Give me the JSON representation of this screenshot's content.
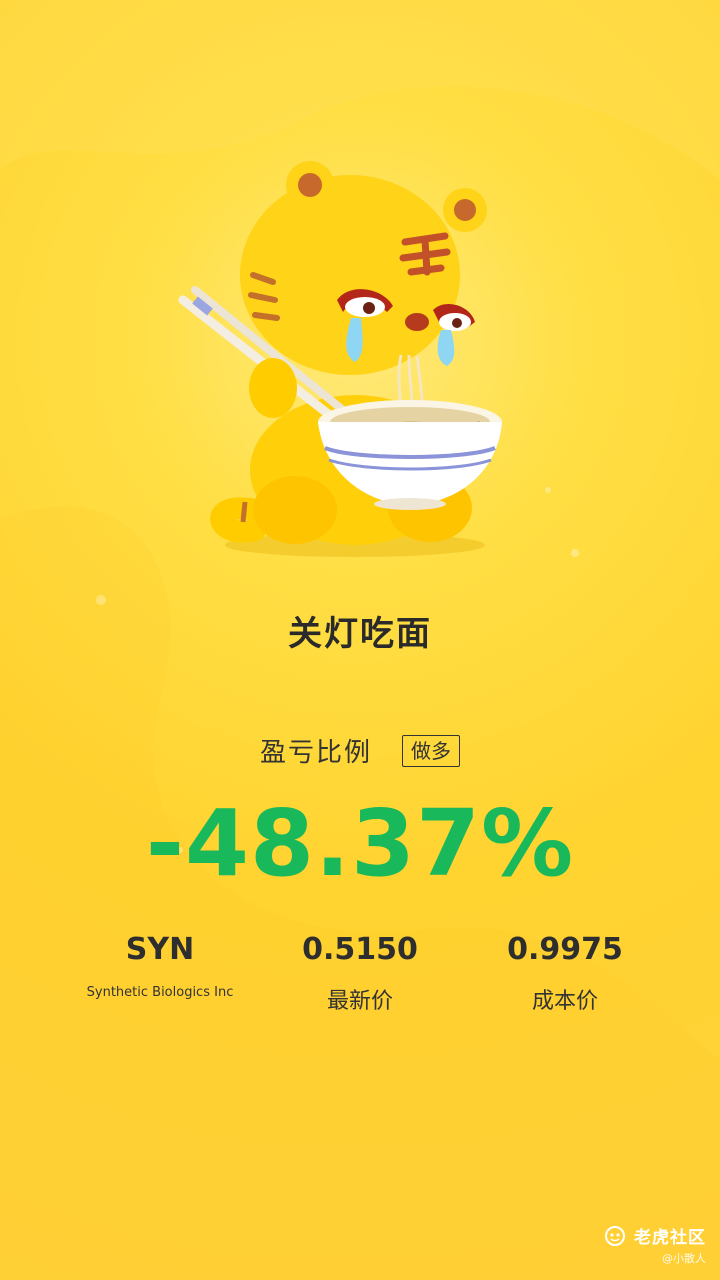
{
  "title": "关灯吃面",
  "ratio_label": "盈亏比例",
  "position_side": "做多",
  "profit_loss_percent": "-48.37%",
  "ticker": {
    "symbol": "SYN",
    "company": "Synthetic Biologics Inc"
  },
  "latest_price": {
    "value": "0.5150",
    "label": "最新价"
  },
  "cost_price": {
    "value": "0.9975",
    "label": "成本价"
  },
  "watermark": {
    "brand": "老虎社区",
    "user": "@小散人"
  },
  "colors": {
    "background": "#ffd330",
    "loss": "#19b85a"
  }
}
